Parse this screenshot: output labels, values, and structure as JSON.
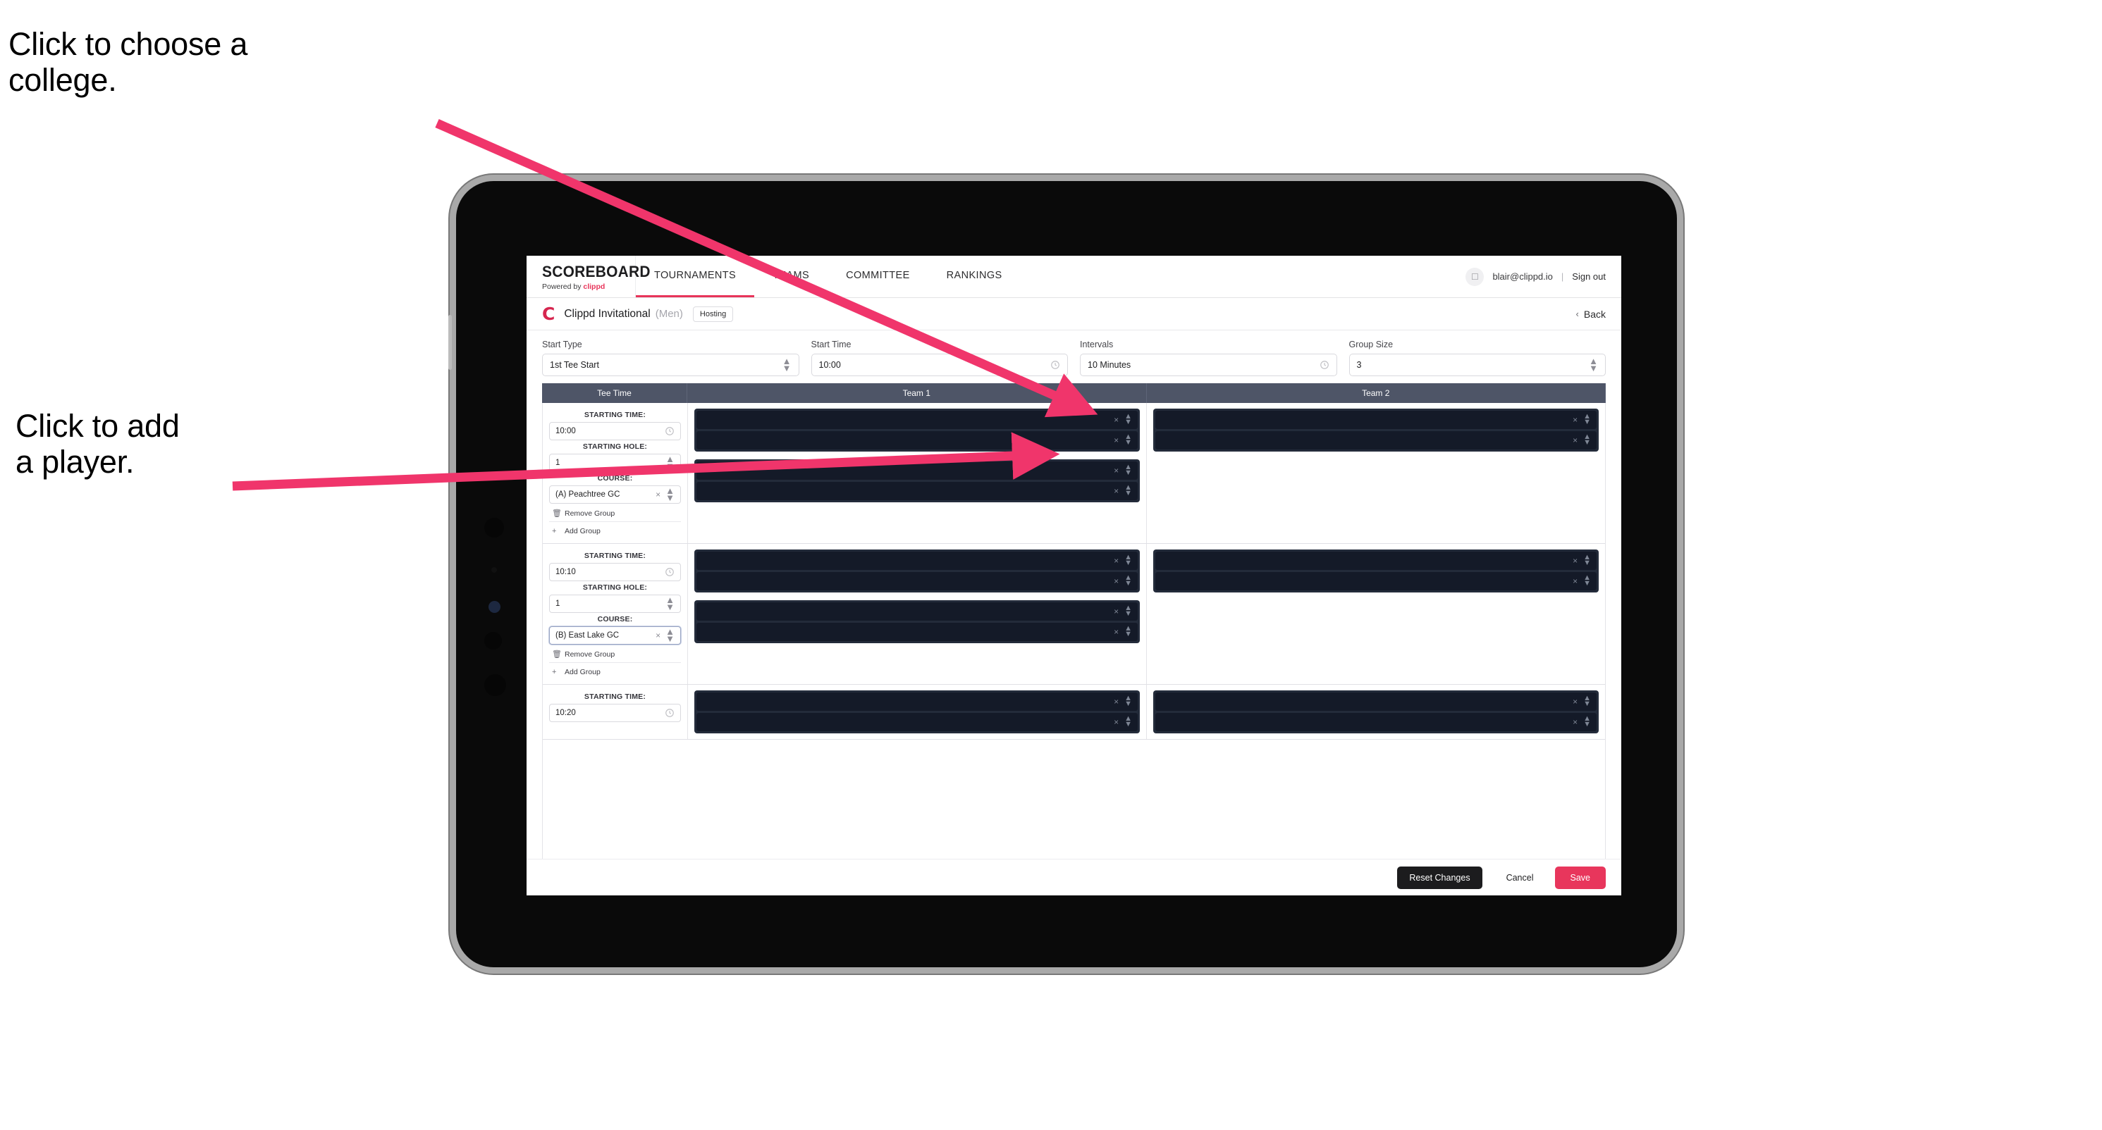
{
  "annotations": {
    "college": "Click to choose a\ncollege.",
    "player": "Click to add\na player."
  },
  "colors": {
    "accent": "#e8345a",
    "save": "#e8365c",
    "table_header": "#4e5567",
    "slot_container": "#232b3a",
    "slot": "#141a28",
    "arrow": "#f0356b"
  },
  "topnav": {
    "brand_title": "SCOREBOARD",
    "brand_sub_prefix": "Powered by ",
    "brand_sub_name": "clippd",
    "tabs": [
      {
        "label": "TOURNAMENTS",
        "active": true
      },
      {
        "label": "TEAMS",
        "active": false
      },
      {
        "label": "COMMITTEE",
        "active": false
      },
      {
        "label": "RANKINGS",
        "active": false
      }
    ],
    "avatar_icon": "user-avatar-icon",
    "user_email": "blair@clippd.io",
    "separator": "|",
    "sign_out": "Sign out"
  },
  "tournament_bar": {
    "logo_letter": "C",
    "name": "Clippd Invitational",
    "gender": "(Men)",
    "badge": "Hosting",
    "back_chevron": "‹",
    "back_label": "Back"
  },
  "settings": {
    "fields": [
      {
        "label": "Start Type",
        "value": "1st Tee Start",
        "adornment": "spinner"
      },
      {
        "label": "Start Time",
        "value": "10:00",
        "adornment": "clock"
      },
      {
        "label": "Intervals",
        "value": "10 Minutes",
        "adornment": "clock"
      },
      {
        "label": "Group Size",
        "value": "3",
        "adornment": "spinner"
      }
    ]
  },
  "table": {
    "headers": [
      "Tee Time",
      "Team 1",
      "Team 2"
    ],
    "labels": {
      "starting_time": "STARTING TIME:",
      "starting_hole": "STARTING HOLE:",
      "course": "COURSE:",
      "remove_group": "Remove Group",
      "add_group": "Add Group",
      "remove_icon": "trash-icon",
      "add_icon": "plus-icon",
      "clear_icon": "×"
    },
    "groups": [
      {
        "starting_time": "10:00",
        "starting_hole": "1",
        "course": "(A) Peachtree GC",
        "course_focused": false,
        "team1": [
          {
            "slots": [
              "",
              ""
            ]
          },
          {
            "slots": [
              "",
              ""
            ]
          }
        ],
        "team2": [
          {
            "slots": [
              "",
              ""
            ]
          }
        ]
      },
      {
        "starting_time": "10:10",
        "starting_hole": "1",
        "course": "(B) East Lake GC",
        "course_focused": true,
        "team1": [
          {
            "slots": [
              "",
              ""
            ]
          },
          {
            "slots": [
              "",
              ""
            ]
          }
        ],
        "team2": [
          {
            "slots": [
              "",
              ""
            ]
          }
        ]
      },
      {
        "starting_time": "10:20",
        "starting_hole": "",
        "course": "",
        "course_focused": false,
        "team1": [
          {
            "slots": [
              "",
              ""
            ]
          }
        ],
        "team2": [
          {
            "slots": [
              "",
              ""
            ]
          }
        ]
      }
    ]
  },
  "footer": {
    "reset_label": "Reset Changes",
    "cancel_label": "Cancel",
    "save_label": "Save"
  }
}
